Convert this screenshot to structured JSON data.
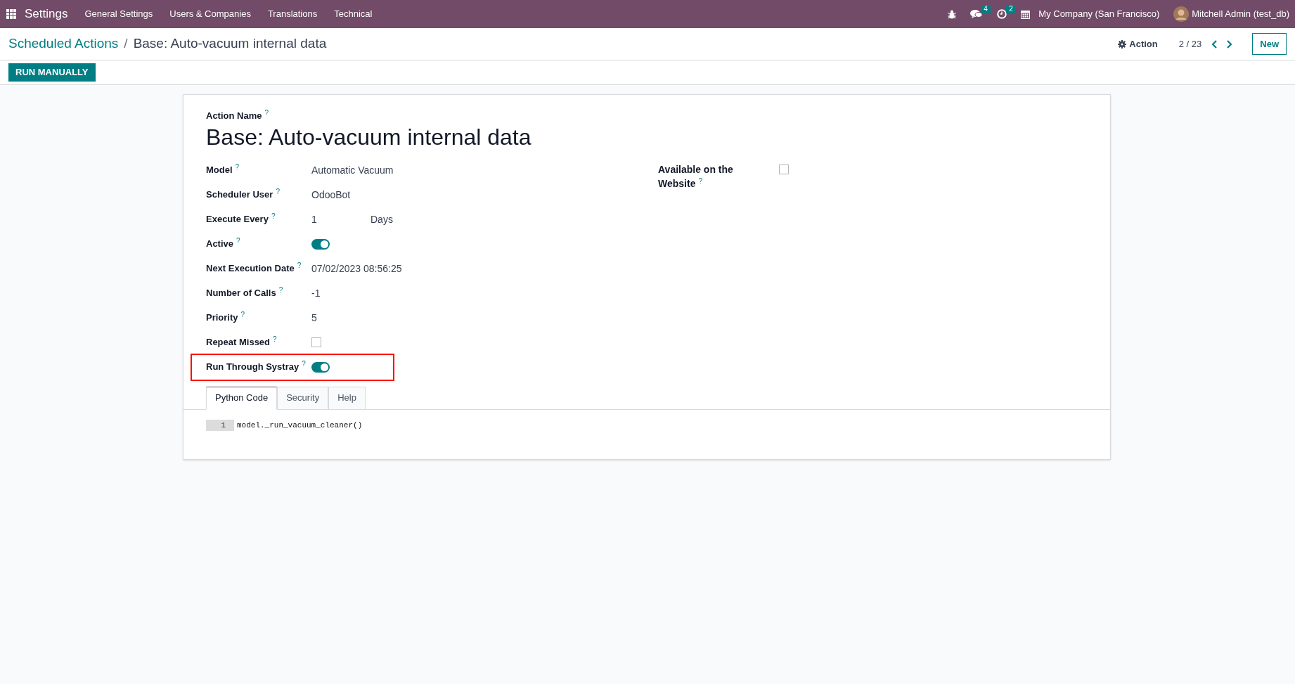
{
  "navbar": {
    "app_title": "Settings",
    "menu": [
      "General Settings",
      "Users & Companies",
      "Translations",
      "Technical"
    ],
    "messages_count": "4",
    "activities_count": "2",
    "company": "My Company (San Francisco)",
    "user": "Mitchell Admin (test_db)"
  },
  "breadcrumb": {
    "parent": "Scheduled Actions",
    "separator": "/",
    "current": "Base: Auto-vacuum internal data"
  },
  "control_panel": {
    "action_label": "Action",
    "pager": "2 / 23",
    "new_button": "New",
    "run_button": "RUN MANUALLY"
  },
  "form": {
    "name_label": "Action Name",
    "name_help": "?",
    "name": "Base: Auto-vacuum internal data",
    "fields": [
      {
        "kind": "text",
        "label": "Model",
        "help": "?",
        "value": "Automatic Vacuum",
        "highlighted": false
      },
      {
        "kind": "text",
        "label": "Scheduler User",
        "help": "?",
        "value": "OdooBot",
        "highlighted": false
      },
      {
        "kind": "interval",
        "label": "Execute Every",
        "help": "?",
        "value": "1",
        "unit": "Days",
        "highlighted": false
      },
      {
        "kind": "toggle",
        "label": "Active",
        "help": "?",
        "on": true,
        "highlighted": false
      },
      {
        "kind": "text",
        "label": "Next Execution Date",
        "help": "?",
        "value": "07/02/2023 08:56:25",
        "highlighted": false
      },
      {
        "kind": "text",
        "label": "Number of Calls",
        "help": "?",
        "value": "-1",
        "highlighted": false
      },
      {
        "kind": "text",
        "label": "Priority",
        "help": "?",
        "value": "5",
        "highlighted": false
      },
      {
        "kind": "checkbox",
        "label": "Repeat Missed",
        "help": "?",
        "checked": false,
        "highlighted": false
      },
      {
        "kind": "toggle",
        "label": "Run Through Systray",
        "help": "?",
        "on": true,
        "highlighted": true
      }
    ],
    "right_fields": [
      {
        "kind": "checkbox",
        "label": "Available on the Website",
        "help": "?",
        "checked": false
      }
    ],
    "tabs": [
      {
        "label": "Python Code",
        "selected": true
      },
      {
        "label": "Security",
        "selected": false
      },
      {
        "label": "Help",
        "selected": false
      }
    ],
    "code_lines": [
      {
        "number": "1",
        "text": "model._run_vacuum_cleaner()"
      }
    ]
  }
}
